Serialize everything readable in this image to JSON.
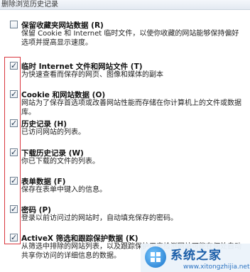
{
  "window": {
    "title": "删除浏览历史记录"
  },
  "options": [
    {
      "title": "保留收藏夹网站数据 (R)",
      "desc": "保留 Cookie 和 Internet 临时文件，以使你收藏的网站能够保持偏好选项并提高显示速度。",
      "checked": false
    },
    {
      "title": "临时 Internet 文件和网站文件 (T)",
      "desc": "为快速查看而保存的网页、图像和媒体的副本",
      "checked": true
    },
    {
      "title": "Cookie 和网站数据 (O)",
      "desc": "网站为了保存首选项或改善网站性能而存储在你计算机上的文件或数据库。",
      "checked": true
    },
    {
      "title": "历史记录 (H)",
      "desc": "已访问网站的列表。",
      "checked": true
    },
    {
      "title": "下载历史记录 (W)",
      "desc": "你已下载的文件的列表。",
      "checked": true
    },
    {
      "title": "表单数据 (F)",
      "desc": "保存在表单中键入的信息。",
      "checked": true
    },
    {
      "title": "密码 (P)",
      "desc": "登录以前访问过的网站时，自动填充保存的密码。",
      "checked": true
    },
    {
      "title": "ActiveX 筛选和跟踪保护数据 (K)",
      "desc": "从筛选中排除的网站列表，以及跟踪保护用来检测网站可能在何处自动共享你访问的详细信息的数据。",
      "checked": true
    }
  ],
  "watermark": {
    "text": "系统之家",
    "url": "www.xitongzhijia.net"
  },
  "colors": {
    "highlight_frame": "#d9363e",
    "check": "#1f3550"
  }
}
